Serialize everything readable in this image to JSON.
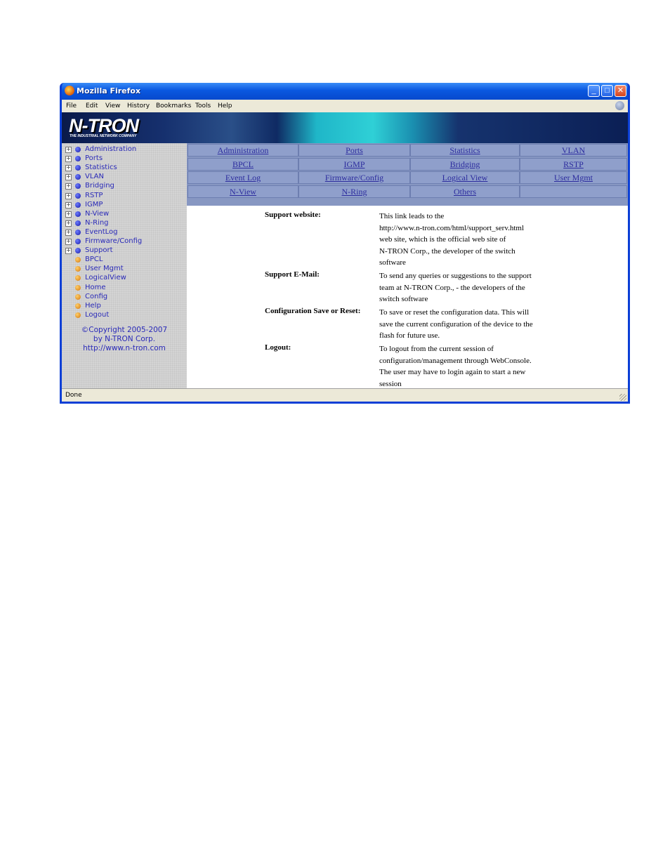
{
  "window": {
    "title": "Mozilla Firefox"
  },
  "menu": [
    "File",
    "Edit",
    "View",
    "History",
    "Bookmarks",
    "Tools",
    "Help"
  ],
  "banner": {
    "logo": "N-TRON",
    "tagline": "THE INDUSTRIAL NETWORK COMPANY"
  },
  "sidebar": {
    "items": [
      {
        "label": "Administration",
        "expandable": true
      },
      {
        "label": "Ports",
        "expandable": true
      },
      {
        "label": "Statistics",
        "expandable": true
      },
      {
        "label": "VLAN",
        "expandable": true
      },
      {
        "label": "Bridging",
        "expandable": true
      },
      {
        "label": "RSTP",
        "expandable": true
      },
      {
        "label": "IGMP",
        "expandable": true
      },
      {
        "label": "N-View",
        "expandable": true
      },
      {
        "label": "N-Ring",
        "expandable": true
      },
      {
        "label": "EventLog",
        "expandable": true
      },
      {
        "label": "Firmware/Config",
        "expandable": true
      },
      {
        "label": "Support",
        "expandable": true
      },
      {
        "label": "BPCL",
        "expandable": false
      },
      {
        "label": "User Mgmt",
        "expandable": false
      },
      {
        "label": "LogicalView",
        "expandable": false
      },
      {
        "label": "Home",
        "expandable": false
      },
      {
        "label": "Config",
        "expandable": false
      },
      {
        "label": "Help",
        "expandable": false
      },
      {
        "label": "Logout",
        "expandable": false
      }
    ],
    "copyright": [
      "©Copyright 2005-2007",
      "by N-TRON Corp.",
      "http://www.n-tron.com"
    ]
  },
  "nav_grid": [
    [
      "Administration",
      "Ports",
      "Statistics",
      "VLAN"
    ],
    [
      "BPCL",
      "IGMP",
      "Bridging",
      "RSTP"
    ],
    [
      "Event Log",
      "Firmware/Config",
      "Logical View",
      "User Mgmt"
    ],
    [
      "N-View",
      "N-Ring",
      "Others",
      ""
    ]
  ],
  "help_entries": [
    {
      "label": "Support website:",
      "lines": [
        "This link leads to the",
        "http://www.n-tron.com/html/support_serv.html",
        "web site, which is the official web site of",
        "N-TRON Corp., the developer of the switch",
        "software"
      ]
    },
    {
      "label": "Support E-Mail:",
      "lines": [
        "To send any queries or suggestions to the support",
        "team at N-TRON Corp., - the developers of the",
        "switch software"
      ]
    },
    {
      "label": "Configuration Save or Reset:",
      "lines": [
        "To save or reset the configuration data. This will",
        "save the current configuration of the device to the",
        "flash for future use."
      ]
    },
    {
      "label": "Logout:",
      "lines": [
        "To logout from the current session of",
        "configuration/management through WebConsole.",
        "The user may have to login again to start a new",
        "session"
      ]
    }
  ],
  "status": {
    "text": "Done"
  },
  "colors": {
    "title_bar": "#0a58e0",
    "link": "#2c2c9e",
    "nav_grid": "#8f9fcb",
    "sidebar_bg": "#d4d4d4"
  },
  "icons": [
    "firefox-icon",
    "minimize-icon",
    "maximize-icon",
    "close-icon",
    "throbber-icon",
    "expand-plus-icon",
    "blue-bullet-icon",
    "orange-bullet-icon",
    "resize-grip-icon"
  ]
}
